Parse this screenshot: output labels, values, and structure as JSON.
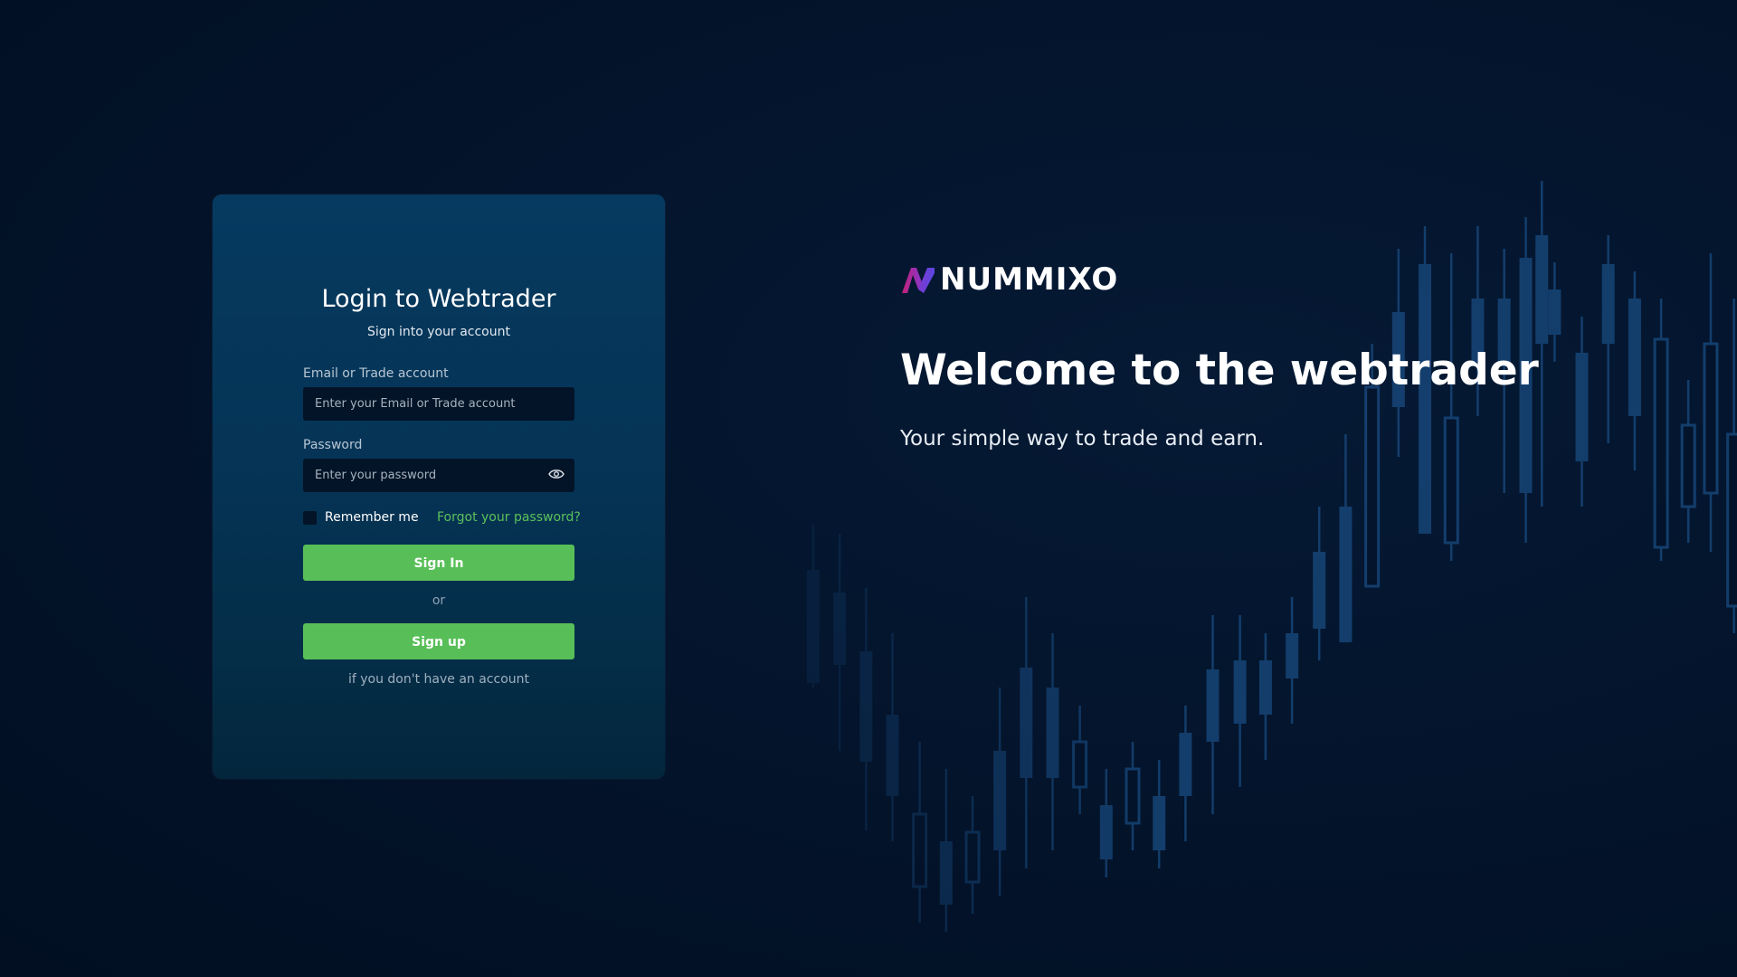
{
  "login": {
    "title": "Login to Webtrader",
    "subtitle": "Sign into your account",
    "email_label": "Email or Trade account",
    "email_placeholder": "Enter your Email or Trade account",
    "email_value": "",
    "password_label": "Password",
    "password_placeholder": "Enter your password",
    "password_value": "",
    "remember_label": "Remember me",
    "remember_checked": false,
    "forgot_label": "Forgot your password?",
    "sign_in_label": "Sign In",
    "or_label": "or",
    "sign_up_label": "Sign up",
    "no_account_label": "if you don't have an account",
    "eye_icon": "eye-icon"
  },
  "welcome": {
    "brand_name": "NUMMIXO",
    "title": "Welcome to the webtrader",
    "subtitle": "Your simple way to trade and earn."
  },
  "colors": {
    "background": "#03132a",
    "card": "#053456",
    "input": "#031428",
    "accent_green": "#58bf58",
    "link_green": "#5bc15b",
    "logo_magenta": "#c4217a",
    "logo_violet": "#6a3fd6"
  }
}
